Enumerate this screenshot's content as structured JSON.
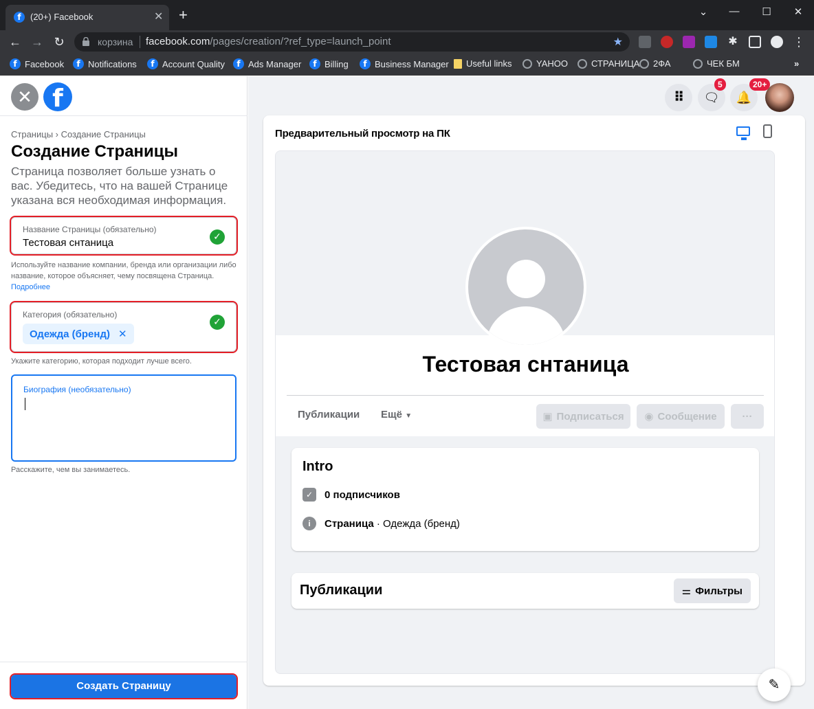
{
  "browser": {
    "tab_title": "(20+) Facebook",
    "site_label": "корзина",
    "url_domain": "facebook.com",
    "url_path": "/pages/creation/?ref_type=launch_point",
    "bookmarks": [
      {
        "label": "Facebook",
        "icon": "facebook-icon"
      },
      {
        "label": "Notifications",
        "icon": "facebook-icon"
      },
      {
        "label": "Account Quality",
        "icon": "facebook-icon"
      },
      {
        "label": "Ads Manager",
        "icon": "facebook-icon"
      },
      {
        "label": "Billing",
        "icon": "facebook-icon"
      },
      {
        "label": "Business Manager",
        "icon": "facebook-icon"
      },
      {
        "label": "Useful links",
        "icon": "folder-icon"
      },
      {
        "label": "YAHOO",
        "icon": "globe-icon"
      },
      {
        "label": "СТРАНИЦА",
        "icon": "globe-icon"
      },
      {
        "label": "2ФА",
        "icon": "globe-icon"
      },
      {
        "label": "ЧЕК БМ",
        "icon": "globe-icon"
      }
    ]
  },
  "left": {
    "breadcrumb": "Страницы › Создание Страницы",
    "title": "Создание Страницы",
    "description": "Страница позволяет больше узнать о вас. Убедитесь, что на вашей Странице указана вся необходимая информация.",
    "name_field": {
      "label": "Название Страницы (обязательно)",
      "value": "Тестовая снтаница",
      "help": "Используйте название компании, бренда или организации либо название, которое объясняет, чему посвящена Страница.",
      "help_link": "Подробнее"
    },
    "category_field": {
      "label": "Категория (обязательно)",
      "chip": "Одежда (бренд)",
      "help": "Укажите категорию, которая подходит лучше всего."
    },
    "bio_field": {
      "label": "Биография (необязательно)",
      "value": "",
      "help": "Расскажите, чем вы занимаетесь."
    },
    "create_button": "Создать Страницу"
  },
  "right": {
    "messenger_badge": "5",
    "notif_badge": "20+",
    "preview_label": "Предварительный просмотр на ПК",
    "page_name": "Тестовая снтаница",
    "tabs": [
      "Публикации",
      "Ещё"
    ],
    "follow_button": "Подписаться",
    "message_button": "Сообщение",
    "more_button": "···",
    "intro": {
      "title": "Intro",
      "followers": "0 подписчиков",
      "page_type": "Страница",
      "category": " · Одежда (бренд)"
    },
    "posts": {
      "title": "Публикации",
      "filters": "Фильтры"
    }
  },
  "colors": {
    "accent": "#1877f2",
    "highlight_box": "#e41e26",
    "success": "#20a337"
  }
}
